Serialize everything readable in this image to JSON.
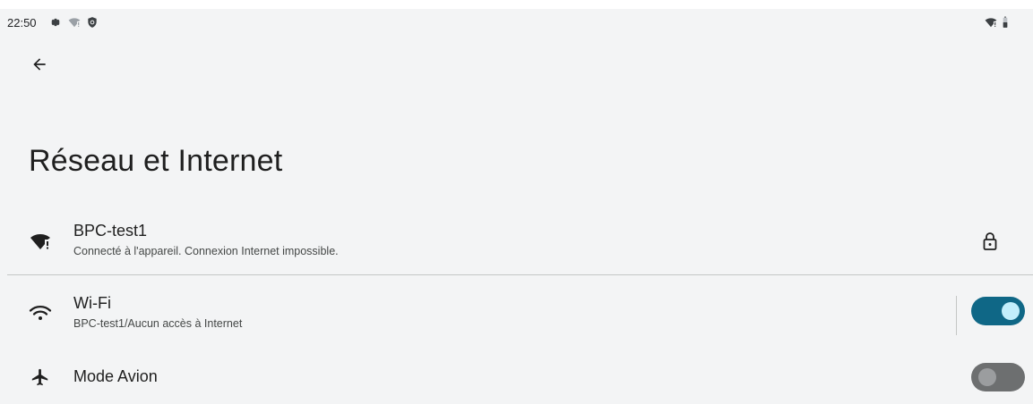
{
  "status_bar": {
    "time": "22:50",
    "icons": [
      "gear-icon",
      "wifi-alert-icon",
      "shield-icon",
      "wifi-alert-icon",
      "battery-icon"
    ]
  },
  "page": {
    "title": "Réseau et Internet"
  },
  "network_row": {
    "title": "BPC-test1",
    "subtitle": "Connecté à l'appareil. Connexion Internet impossible.",
    "icon": "wifi-alert-icon",
    "trailing_icon": "lock-icon"
  },
  "wifi_row": {
    "title": "Wi-Fi",
    "subtitle": "BPC-test1/Aucun accès à Internet",
    "icon": "wifi-icon",
    "toggle_on": true
  },
  "airplane_row": {
    "title": "Mode Avion",
    "icon": "airplane-icon",
    "toggle_on": false
  },
  "colors": {
    "background": "#f3f4f5",
    "toggle_on_track": "#0f6786",
    "toggle_on_thumb": "#c2eefb",
    "toggle_off_track": "#6d6f70",
    "toggle_off_thumb": "#9b9d9f"
  }
}
